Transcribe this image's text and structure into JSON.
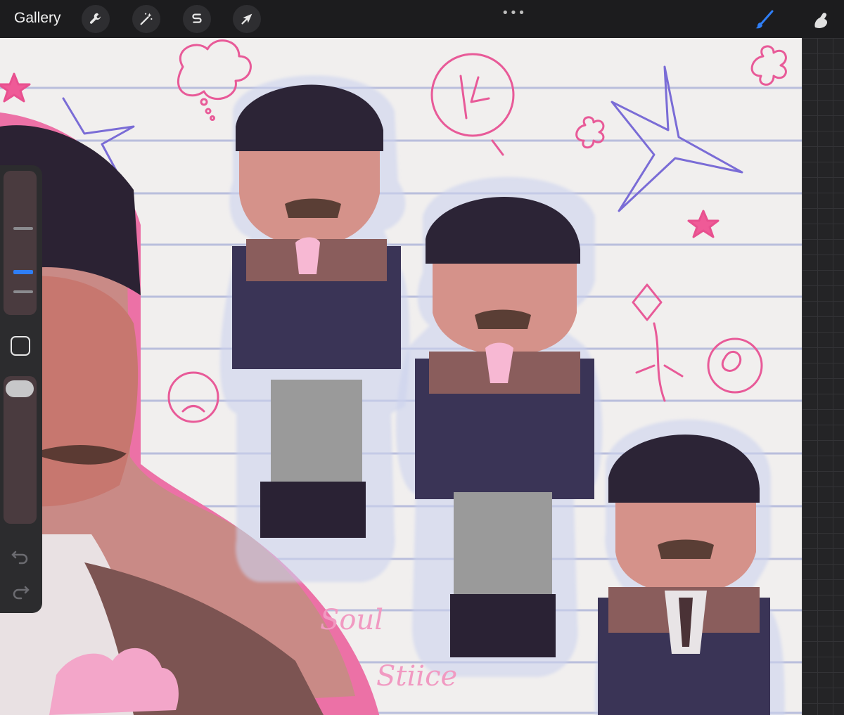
{
  "topbar": {
    "gallery_label": "Gallery",
    "tools": [
      {
        "name": "actions",
        "icon": "wrench-icon"
      },
      {
        "name": "adjustments",
        "icon": "magic-wand-icon"
      },
      {
        "name": "selection",
        "icon": "selection-s-icon"
      },
      {
        "name": "transform",
        "icon": "arrow-cursor-icon"
      }
    ],
    "more_label": "•••",
    "brush_icon": "paintbrush-icon",
    "smudge_icon": "smudge-finger-icon",
    "accent_color": "#2f7ef6"
  },
  "artwork": {
    "signature_lines": [
      "Soul",
      "Stiice"
    ]
  },
  "sidebar": {
    "icons": [
      "brush-size-slider",
      "modify-square-icon",
      "opacity-slider",
      "undo-icon",
      "redo-icon"
    ]
  }
}
